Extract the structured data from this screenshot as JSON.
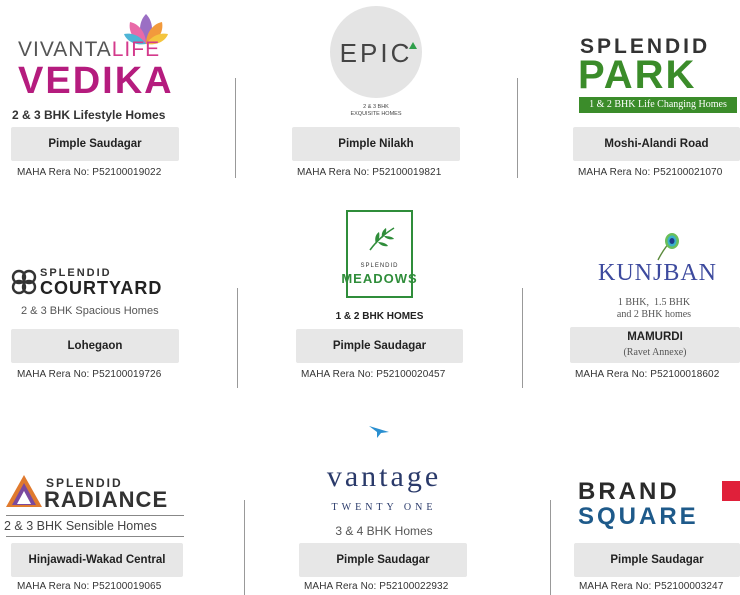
{
  "projects": [
    {
      "brand_line1": "VIVANTA",
      "brand_line1b": "LIFE",
      "brand_line2": "VEDIKA",
      "tagline": "2 & 3 BHK Lifestyle Homes",
      "location": "Pimple Saudagar",
      "rera": "MAHA Rera No: P52100019022",
      "icon": "lotus-icon",
      "accent": "#b51c7e"
    },
    {
      "brand": "EPIC",
      "sub1": "2 & 3 BHK",
      "sub2": "EXQUISITE HOMES",
      "location": "Pimple Nilakh",
      "rera": "MAHA Rera No: P52100019821",
      "accent": "#2e9e4a"
    },
    {
      "brand_line1": "SPLENDID",
      "brand_line2": "PARK",
      "tagline": "1 & 2 BHK Life Changing Homes",
      "location": "Moshi-Alandi Road",
      "rera": "MAHA Rera No: P52100021070",
      "accent": "#3b8c2a"
    },
    {
      "brand_line1": "SPLENDID",
      "brand_line2": "COURTYARD",
      "tagline": "2 & 3 BHK Spacious Homes",
      "location": "Lohegaon",
      "rera": "MAHA Rera No: P52100019726",
      "icon": "clover-icon"
    },
    {
      "brand_line1": "SPLENDID",
      "brand_line2": "MEADOWS",
      "tagline": "1 & 2 BHK HOMES",
      "location": "Pimple Saudagar",
      "rera": "MAHA Rera No: P52100020457",
      "icon": "leaf-icon",
      "accent": "#2f8d3a"
    },
    {
      "brand": "KUNJBAN",
      "tagline1": "1 BHK,  1.5 BHK",
      "tagline2": "and 2 BHK homes",
      "location": "MAMURDI",
      "location_sub": "(Ravet Annexe)",
      "rera": "MAHA Rera No: P52100018602",
      "icon": "peacock-feather-icon",
      "accent": "#3d4a9e"
    },
    {
      "brand_line1": "SPLENDID",
      "brand_line2": "RADIANCE",
      "tagline": "2 & 3 BHK Sensible Homes",
      "location": "Hinjawadi-Wakad Central",
      "rera": "MAHA Rera No: P52100019065",
      "icon": "triangle-logo-icon"
    },
    {
      "brand": "vantage",
      "sub": "TWENTY ONE",
      "tagline": "3 & 4 BHK Homes",
      "location": "Pimple Saudagar",
      "rera": "MAHA Rera No: P52100022932",
      "icon": "bird-icon",
      "accent": "#2a3a6a"
    },
    {
      "brand_line1": "BRAND",
      "brand_line2": "SQUARE",
      "location": "Pimple Saudagar",
      "rera": "MAHA Rera No: P52100003247",
      "accent": "#e0203a"
    }
  ]
}
